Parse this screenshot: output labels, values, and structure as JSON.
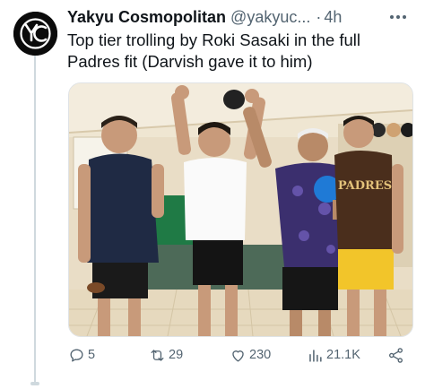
{
  "tweet": {
    "author_name": "Yakyu Cosmopolitan",
    "author_handle": "@yakyuc...",
    "separator": "·",
    "time": "4h",
    "avatar_initials": "YC",
    "text_line1": "Top tier trolling by Roki Sasaki in the full",
    "text_line2": "Padres fit (Darvish gave it to him)",
    "image": {
      "description_icon": "photo",
      "shirt_text": "PADRES"
    }
  },
  "actions": {
    "replies": "5",
    "retweets": "29",
    "likes": "230",
    "views": "21.1K"
  },
  "colors": {
    "text": "#0f1419",
    "secondary": "#536471",
    "border": "#cfd9de"
  }
}
